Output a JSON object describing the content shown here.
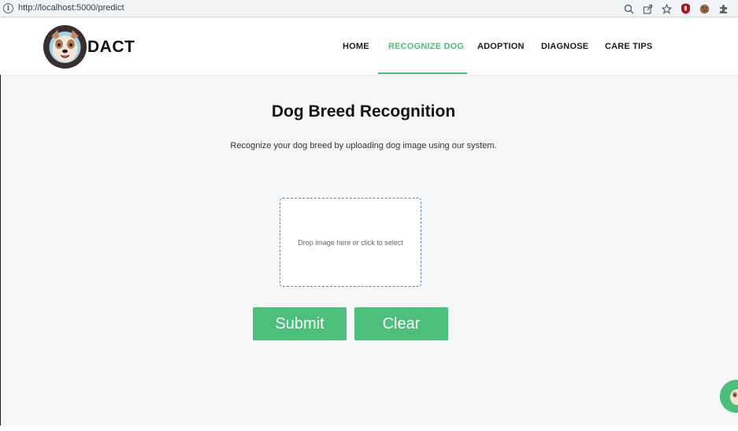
{
  "browser": {
    "url": "http://localhost:5000/predict",
    "icons": [
      "info-icon",
      "zoom-icon",
      "share-icon",
      "star-icon",
      "extension-shield-icon",
      "cookie-icon",
      "puzzle-icon"
    ]
  },
  "header": {
    "brand": "DACT",
    "nav": [
      {
        "label": "HOME",
        "active": false
      },
      {
        "label": "RECOGNIZE DOG",
        "active": true
      },
      {
        "label": "ADOPTION",
        "active": false
      },
      {
        "label": "DIAGNOSE",
        "active": false
      },
      {
        "label": "CARE TIPS",
        "active": false
      }
    ]
  },
  "main": {
    "title": "Dog Breed Recognition",
    "subtitle": "Recognize your dog breed by uploading dog image using our system.",
    "dropzone_text": "Drop image here or click to select",
    "submit_label": "Submit",
    "clear_label": "Clear"
  },
  "colors": {
    "accent": "#4cbf7a",
    "page_bg": "#f6f7f9",
    "dropzone_border": "#5f87a9"
  }
}
